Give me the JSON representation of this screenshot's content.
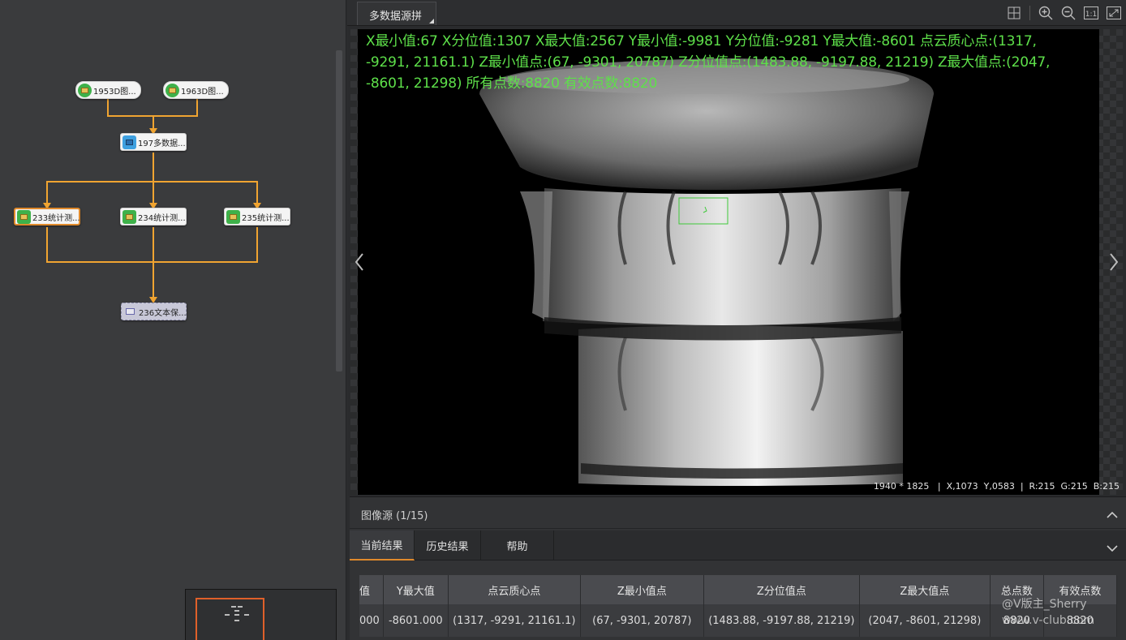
{
  "flow": {
    "nodes": [
      {
        "id": "n1953",
        "label": "1953D图...",
        "style": "pill"
      },
      {
        "id": "n1963",
        "label": "1963D图...",
        "style": "pill"
      },
      {
        "id": "n197",
        "label": "197多数据...",
        "style": "rect"
      },
      {
        "id": "n233",
        "label": "233统计测...",
        "style": "rect",
        "selected": true
      },
      {
        "id": "n234",
        "label": "234统计测...",
        "style": "rect"
      },
      {
        "id": "n235",
        "label": "235统计测...",
        "style": "rect"
      },
      {
        "id": "n236",
        "label": "236文本保...",
        "style": "ghost"
      }
    ],
    "accent_color": "#f0a431"
  },
  "viewer": {
    "tab_label": "多数据源拼",
    "tools": [
      "grid-icon",
      "zoom-in-icon",
      "zoom-out-icon",
      "actual-size-icon",
      "fit-window-icon"
    ],
    "actual_size_label": "1:1",
    "stats_overlay": "X最小值:67 X分位值:1307 X最大值:2567 Y最小值:-9981 Y分位值:-9281 Y最大值:-8601 点云质心点:(1317, -9291, 21161.1) Z最小值点:(67, -9301, 20787) Z分位值点:(1483.88, -9197.88, 21219) Z最大值点:(2047, -8601, 21298) 所有点数:8820 有效点数:8820",
    "overlay_color": "#5ee04a",
    "status": {
      "size": "1940 * 1825",
      "coords": "X,1073  Y,0583",
      "rgb": "R:215  G:215  B:215"
    }
  },
  "results": {
    "title": "图像源 (1/15)",
    "tabs": [
      {
        "label": "当前结果",
        "active": true
      },
      {
        "label": "历史结果",
        "active": false
      },
      {
        "label": "帮助",
        "active": false
      }
    ],
    "columns": [
      "值",
      "Y最大值",
      "点云质心点",
      "Z最小值点",
      "Z分位值点",
      "Z最大值点",
      "总点数",
      "有效点数"
    ],
    "rows": [
      [
        "000",
        "-8601.000",
        "(1317, -9291, 21161.1)",
        "(67, -9301, 20787)",
        "(1483.88, -9197.88, 21219)",
        "(2047, -8601, 21298)",
        "8820",
        "8820"
      ]
    ]
  },
  "watermark": {
    "line1": "@V版主_Sherry",
    "line2": "www.v-club.com"
  }
}
